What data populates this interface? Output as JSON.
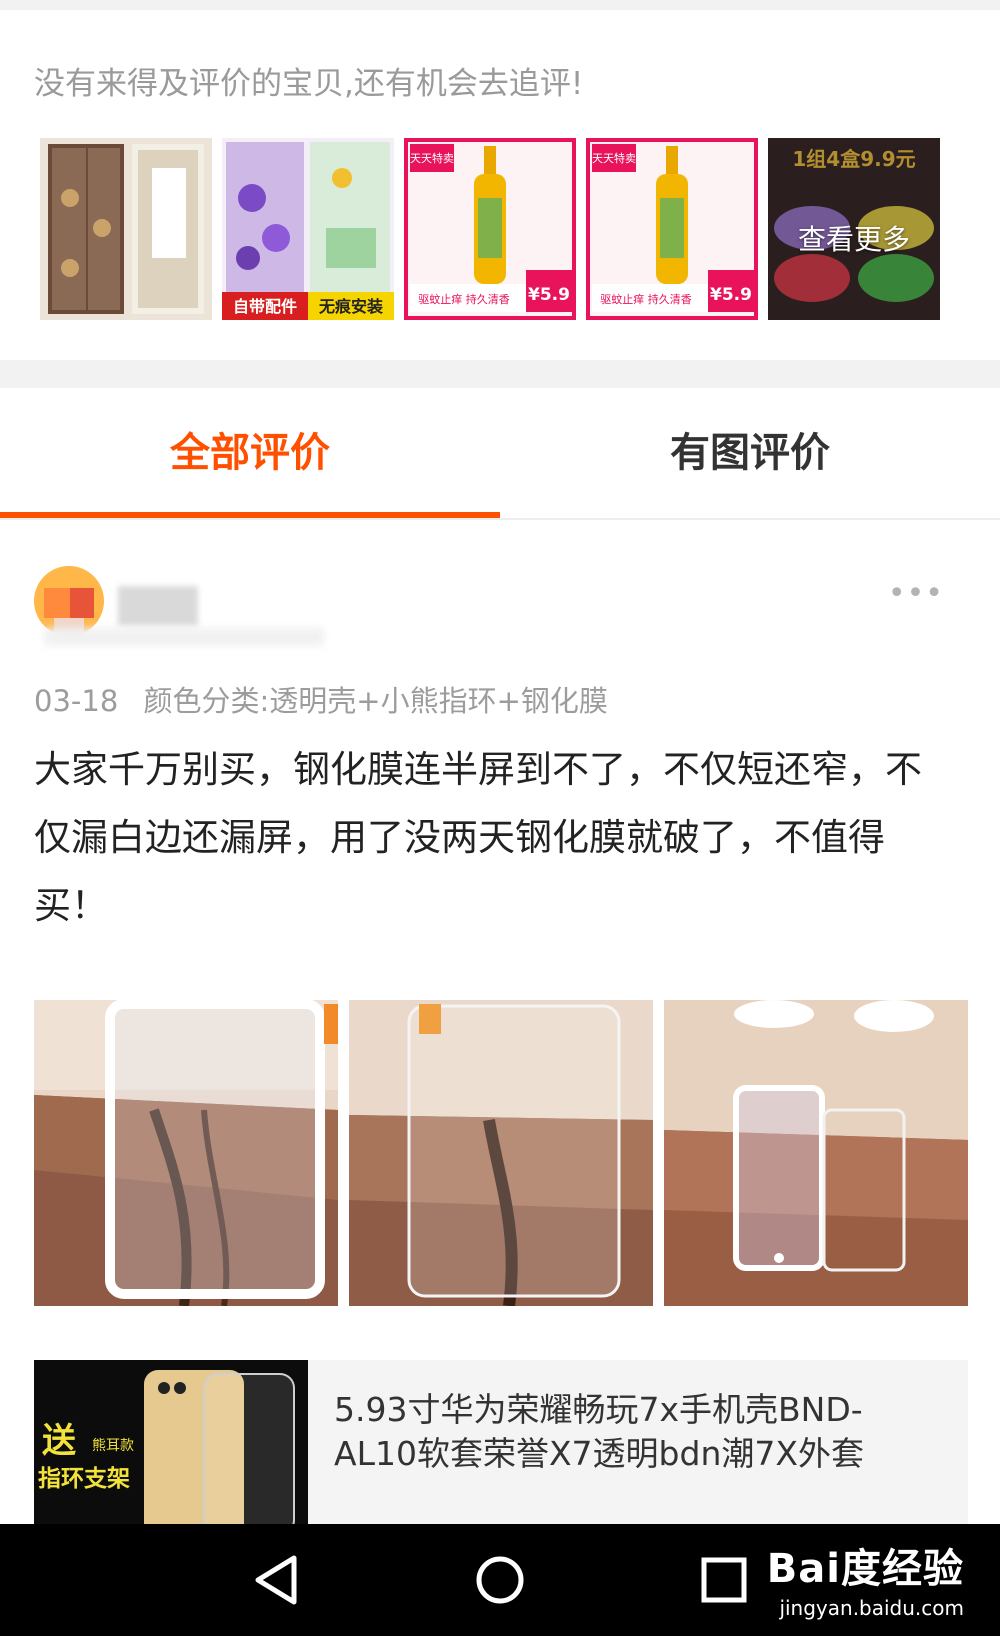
{
  "followup": {
    "prompt": "没有来得及评价的宝贝,还有机会去追评!",
    "more_label": "查看更多",
    "thumbnails": [
      {
        "name": "thumb-door-curtain",
        "badge": ""
      },
      {
        "name": "thumb-flower-curtain",
        "badge": "自带配件 无痕安装"
      },
      {
        "name": "thumb-spray-1",
        "badge": "¥5.9"
      },
      {
        "name": "thumb-spray-2",
        "badge": "¥5.9"
      },
      {
        "name": "thumb-gel-jars",
        "badge": "1组4盒9.9元"
      }
    ]
  },
  "tabs": {
    "all": "全部评价",
    "with_photos": "有图评价"
  },
  "review": {
    "date": "03-18",
    "variant": "颜色分类:透明壳+小熊指环+钢化膜",
    "text": "大家千万别买，钢化膜连半屏到不了，不仅短还窄，不仅漏白边还漏屏，用了没两天钢化膜就破了，不值得买！"
  },
  "product": {
    "promo_text_1": "送",
    "promo_text_2": "熊耳款",
    "promo_text_3": "指环支架",
    "title": "5.93寸华为荣耀畅玩7x手机壳BND-AL10软套荣誉X7透明bdn潮7X外套"
  },
  "watermark": {
    "brand": "Bai度经验",
    "url": "jingyan.baidu.com"
  },
  "colors": {
    "accent": "#ff5000",
    "text_primary": "#222222",
    "text_secondary": "#9c9c9c"
  }
}
